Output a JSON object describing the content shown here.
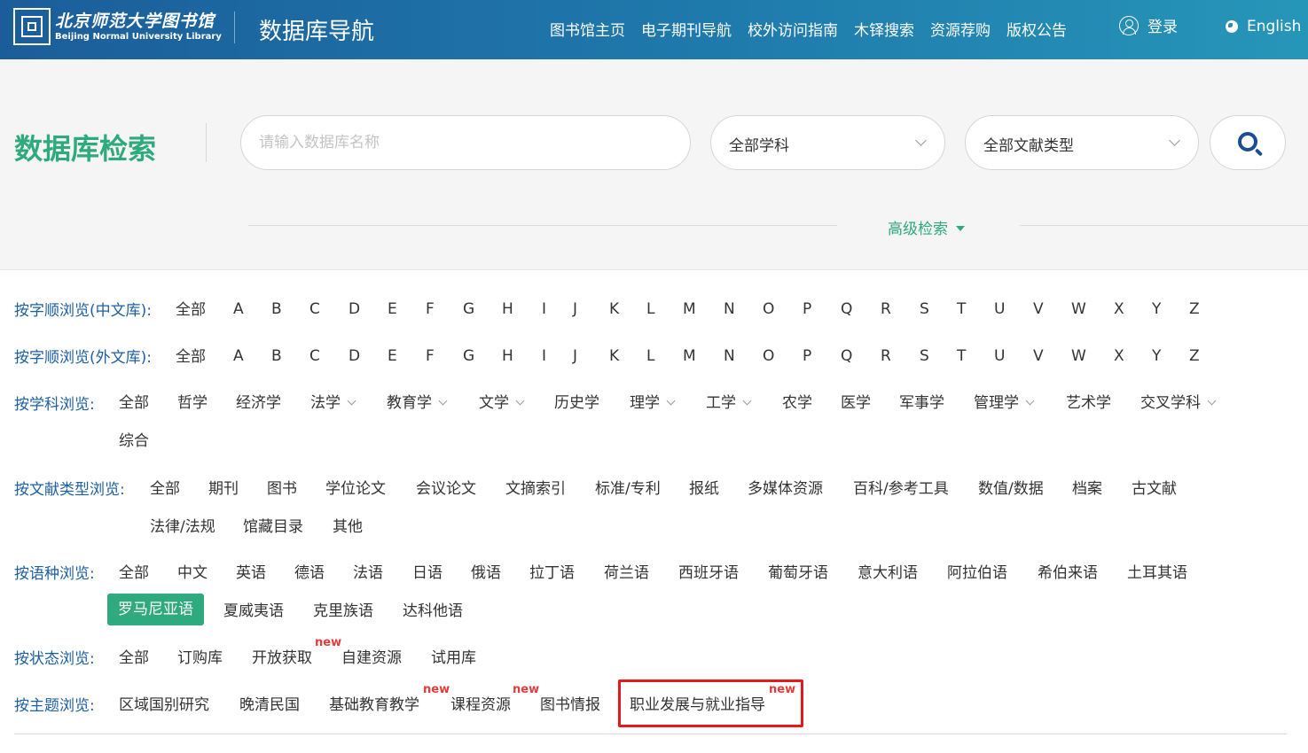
{
  "header": {
    "logo_cn": "北京师范大学图书馆",
    "logo_en": "Beijing Normal University Library",
    "site_title": "数据库导航",
    "nav": [
      "图书馆主页",
      "电子期刊导航",
      "校外访问指南",
      "木铎搜索",
      "资源荐购",
      "版权公告"
    ],
    "login_label": "登录",
    "language_label": "English"
  },
  "search": {
    "heading": "数据库检索",
    "name_placeholder": "请输入数据库名称",
    "subject_value": "全部学科",
    "type_value": "全部文献类型",
    "advanced_label": "高级检索"
  },
  "browse": {
    "alpha_cn_label": "按字顺浏览(中文库):",
    "alpha_en_label": "按字顺浏览(外文库):",
    "alpha_all": "全部",
    "letters": [
      "A",
      "B",
      "C",
      "D",
      "E",
      "F",
      "G",
      "H",
      "I",
      "J",
      "K",
      "L",
      "M",
      "N",
      "O",
      "P",
      "Q",
      "R",
      "S",
      "T",
      "U",
      "V",
      "W",
      "X",
      "Y",
      "Z"
    ],
    "subject_label": "按学科浏览:",
    "subjects": [
      "全部",
      "哲学",
      "经济学",
      "法学",
      "教育学",
      "文学",
      "历史学",
      "理学",
      "工学",
      "农学",
      "医学",
      "军事学",
      "管理学",
      "艺术学",
      "交叉学科",
      "综合"
    ],
    "doctype_label": "按文献类型浏览:",
    "doctypes": [
      "全部",
      "期刊",
      "图书",
      "学位论文",
      "会议论文",
      "文摘索引",
      "标准/专利",
      "报纸",
      "多媒体资源",
      "百科/参考工具",
      "数值/数据",
      "档案",
      "古文献",
      "法律/法规",
      "馆藏目录",
      "其他"
    ],
    "language_label": "按语种浏览:",
    "languages": [
      "全部",
      "中文",
      "英语",
      "德语",
      "法语",
      "日语",
      "俄语",
      "拉丁语",
      "荷兰语",
      "西班牙语",
      "葡萄牙语",
      "意大利语",
      "阿拉伯语",
      "希伯来语",
      "土耳其语",
      "罗马尼亚语",
      "夏威夷语",
      "克里族语",
      "达科他语"
    ],
    "status_label": "按状态浏览:",
    "statuses": [
      "全部",
      "订购库",
      "开放获取",
      "自建资源",
      "试用库"
    ],
    "topic_label": "按主题浏览:",
    "topics": [
      "区域国别研究",
      "晚清民国",
      "基础教育教学",
      "课程资源",
      "图书情报",
      "职业发展与就业指导"
    ],
    "new_tag": "new"
  },
  "colors": {
    "header_start": "#1b5d9a",
    "header_end": "#2696b8",
    "accent_green": "#2fa97e",
    "label_blue": "#1d5fa5",
    "new_red": "#e33c3c",
    "highlight_red": "#e3191c"
  }
}
